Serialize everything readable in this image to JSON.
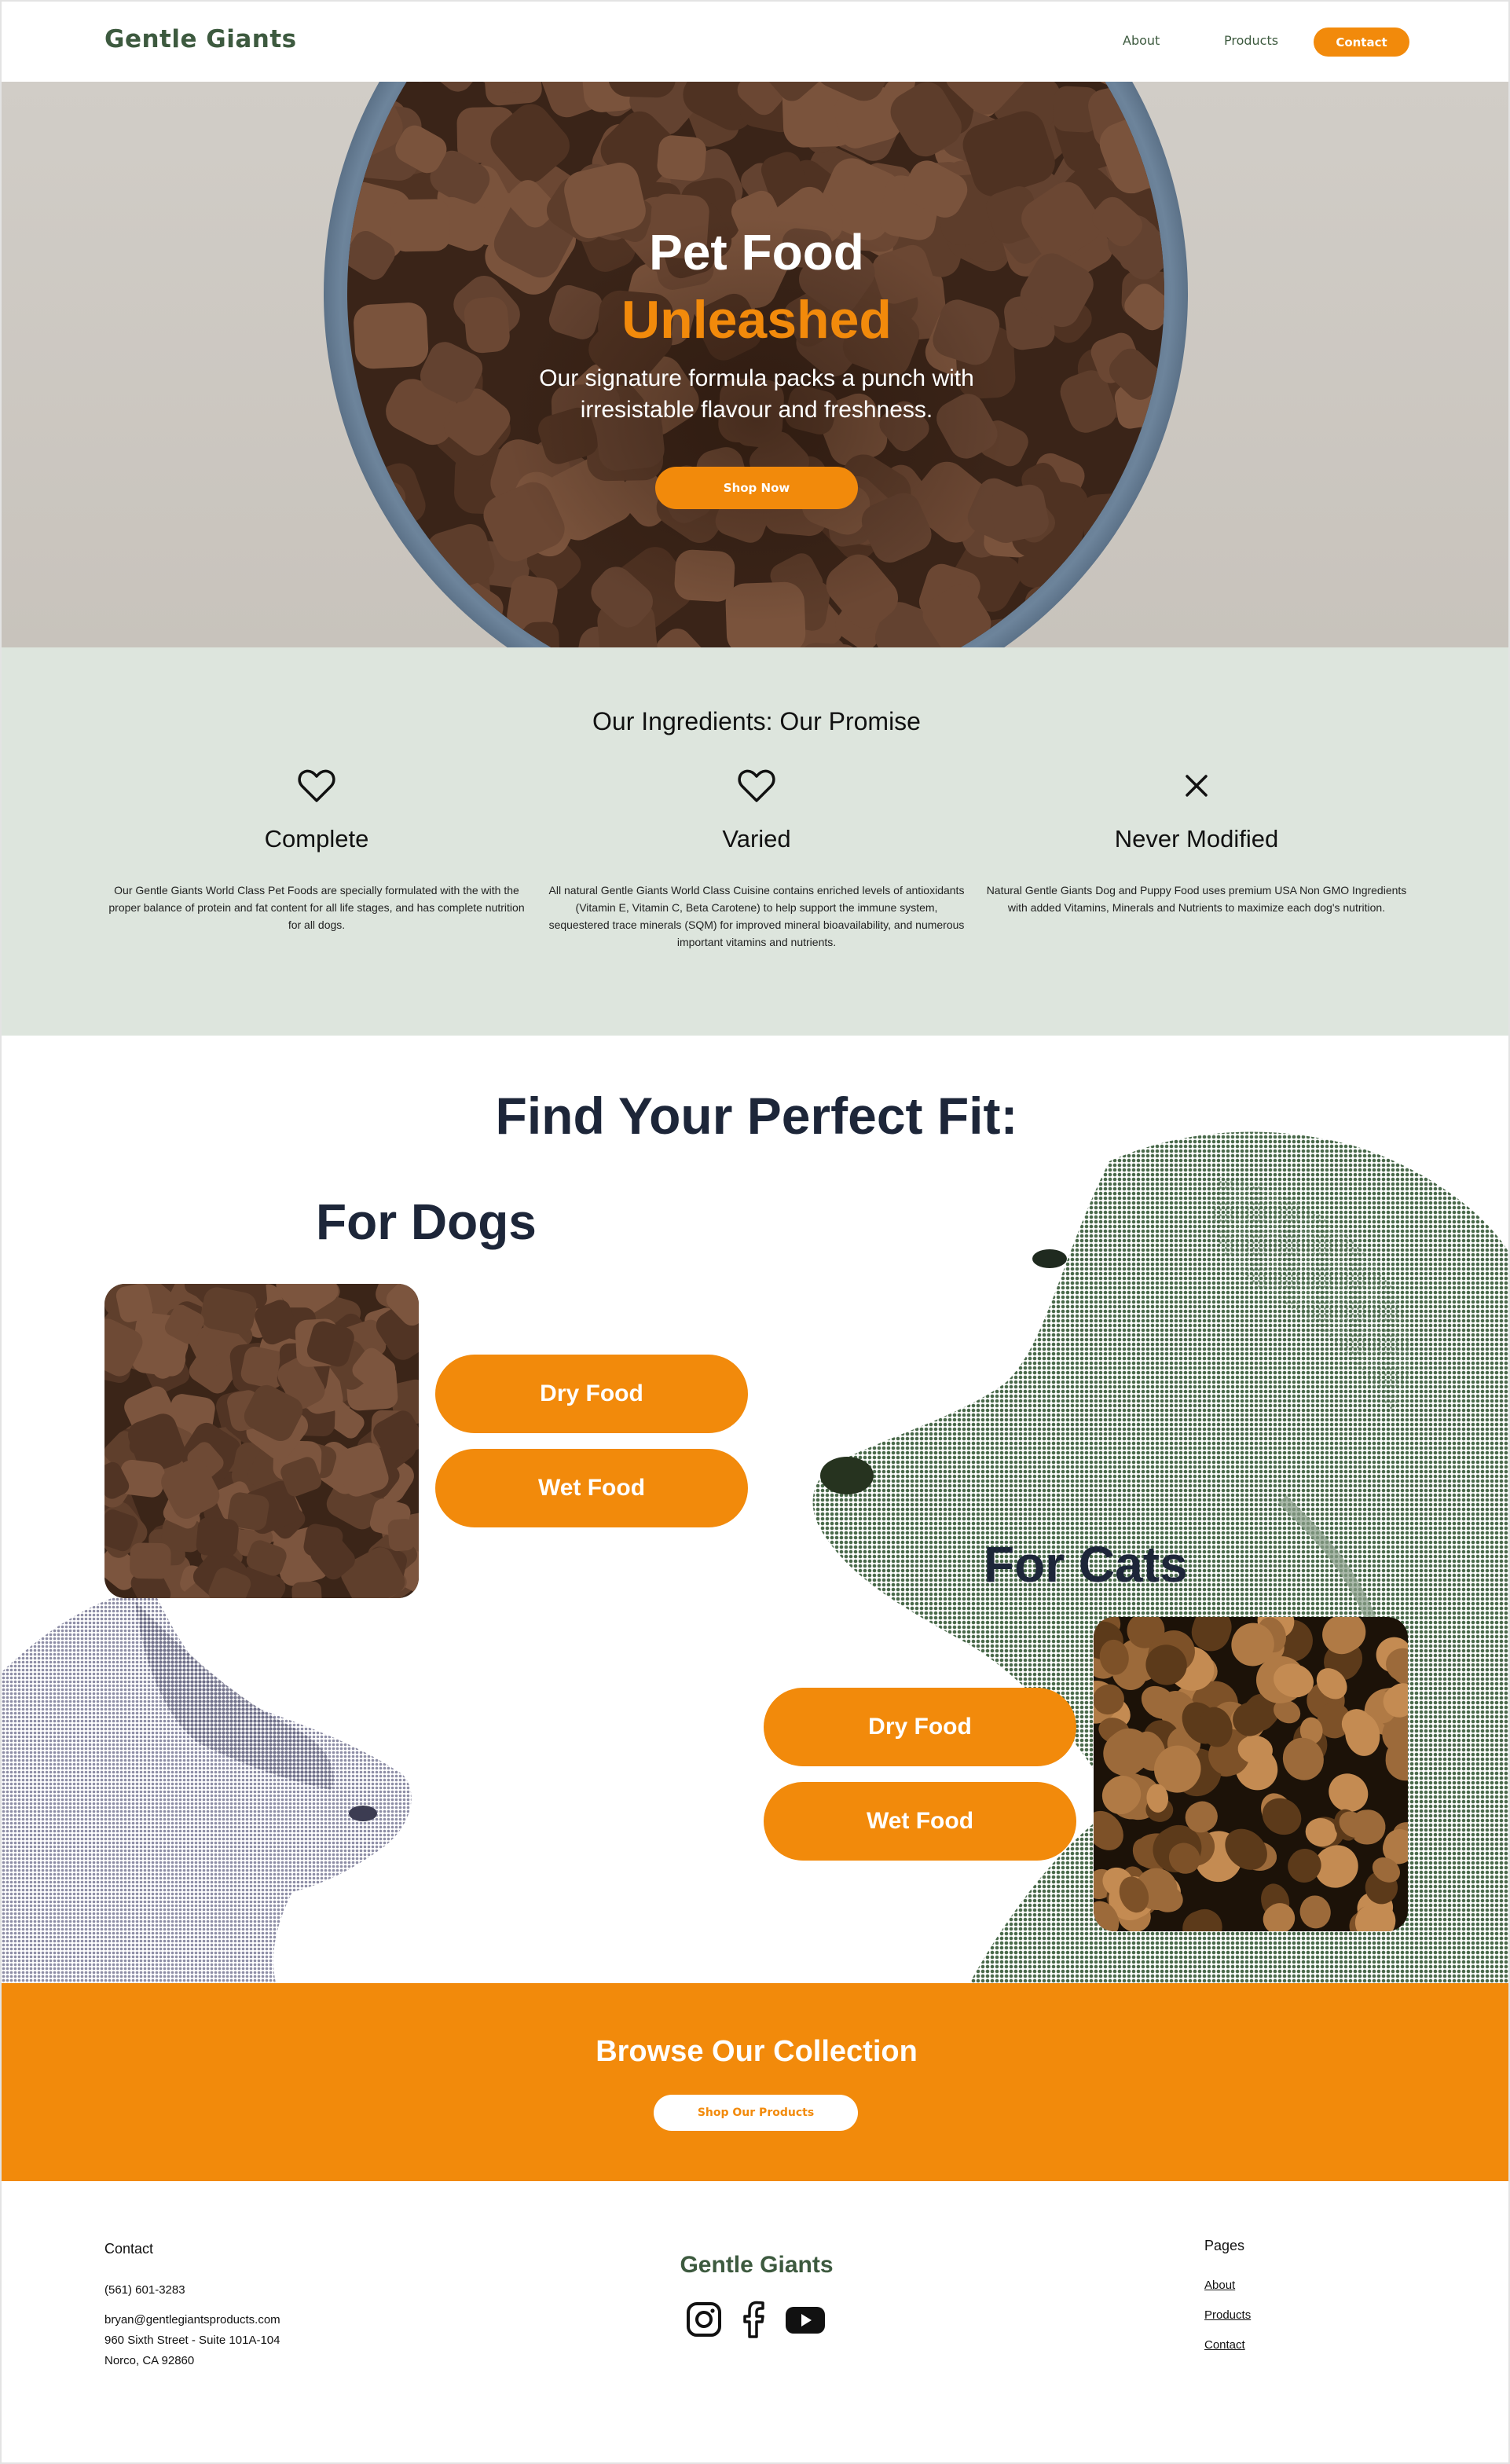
{
  "nav": {
    "brand": "Gentle Giants",
    "links": [
      "About",
      "Products"
    ],
    "contact_label": "Contact"
  },
  "hero": {
    "title_line1": "Pet Food",
    "title_line2": "Unleashed",
    "subtitle": "Our signature formula packs a punch with irresistable flavour and freshness.",
    "cta_label": "Shop Now"
  },
  "ingredients": {
    "title": "Our Ingredients: Our Promise",
    "columns": [
      {
        "icon": "heart-icon",
        "heading": "Complete",
        "text": "Our Gentle Giants World Class Pet Foods are specially formulated with the with the proper balance of protein and fat content for all life stages, and has complete nutrition for all dogs."
      },
      {
        "icon": "heart-icon",
        "heading": "Varied",
        "text": "All natural Gentle Giants World Class  Cuisine contains enriched levels of antioxidants (Vitamin E, Vitamin C, Beta Carotene) to help support the immune system, sequestered trace minerals (SQM) for improved mineral bioavailability, and numerous important vitamins and nutrients."
      },
      {
        "icon": "close-icon",
        "heading": "Never Modified",
        "text": "Natural Gentle Giants Dog and Puppy Food uses premium USA Non GMO Ingredients with added Vitamins, Minerals and Nutrients to maximize each dog's nutrition."
      }
    ]
  },
  "fit": {
    "title": "Find Your Perfect Fit:",
    "dogs": {
      "title": "For Dogs",
      "dry_label": "Dry Food",
      "wet_label": "Wet Food"
    },
    "cats": {
      "title": "For Cats",
      "dry_label": "Dry Food",
      "wet_label": "Wet Food"
    }
  },
  "browse": {
    "title": "Browse Our Collection",
    "cta_label": "Shop Our Products"
  },
  "footer": {
    "contact_heading": "Contact",
    "phone": "(561) 601-3283",
    "email": "bryan@gentlegiantsproducts.com",
    "address_line1": "960 Sixth Street - Suite 101A-104",
    "address_line2": "Norco, CA 92860",
    "brand": "Gentle Giants",
    "socials": [
      "instagram-icon",
      "facebook-icon",
      "youtube-icon"
    ],
    "pages_heading": "Pages",
    "pages": [
      "About",
      "Products",
      "Contact"
    ]
  },
  "colors": {
    "accent": "#f28a0b",
    "brand_green": "#3d5a3f",
    "ingredients_bg": "#dde5dd",
    "heading_navy": "#1d2639"
  }
}
